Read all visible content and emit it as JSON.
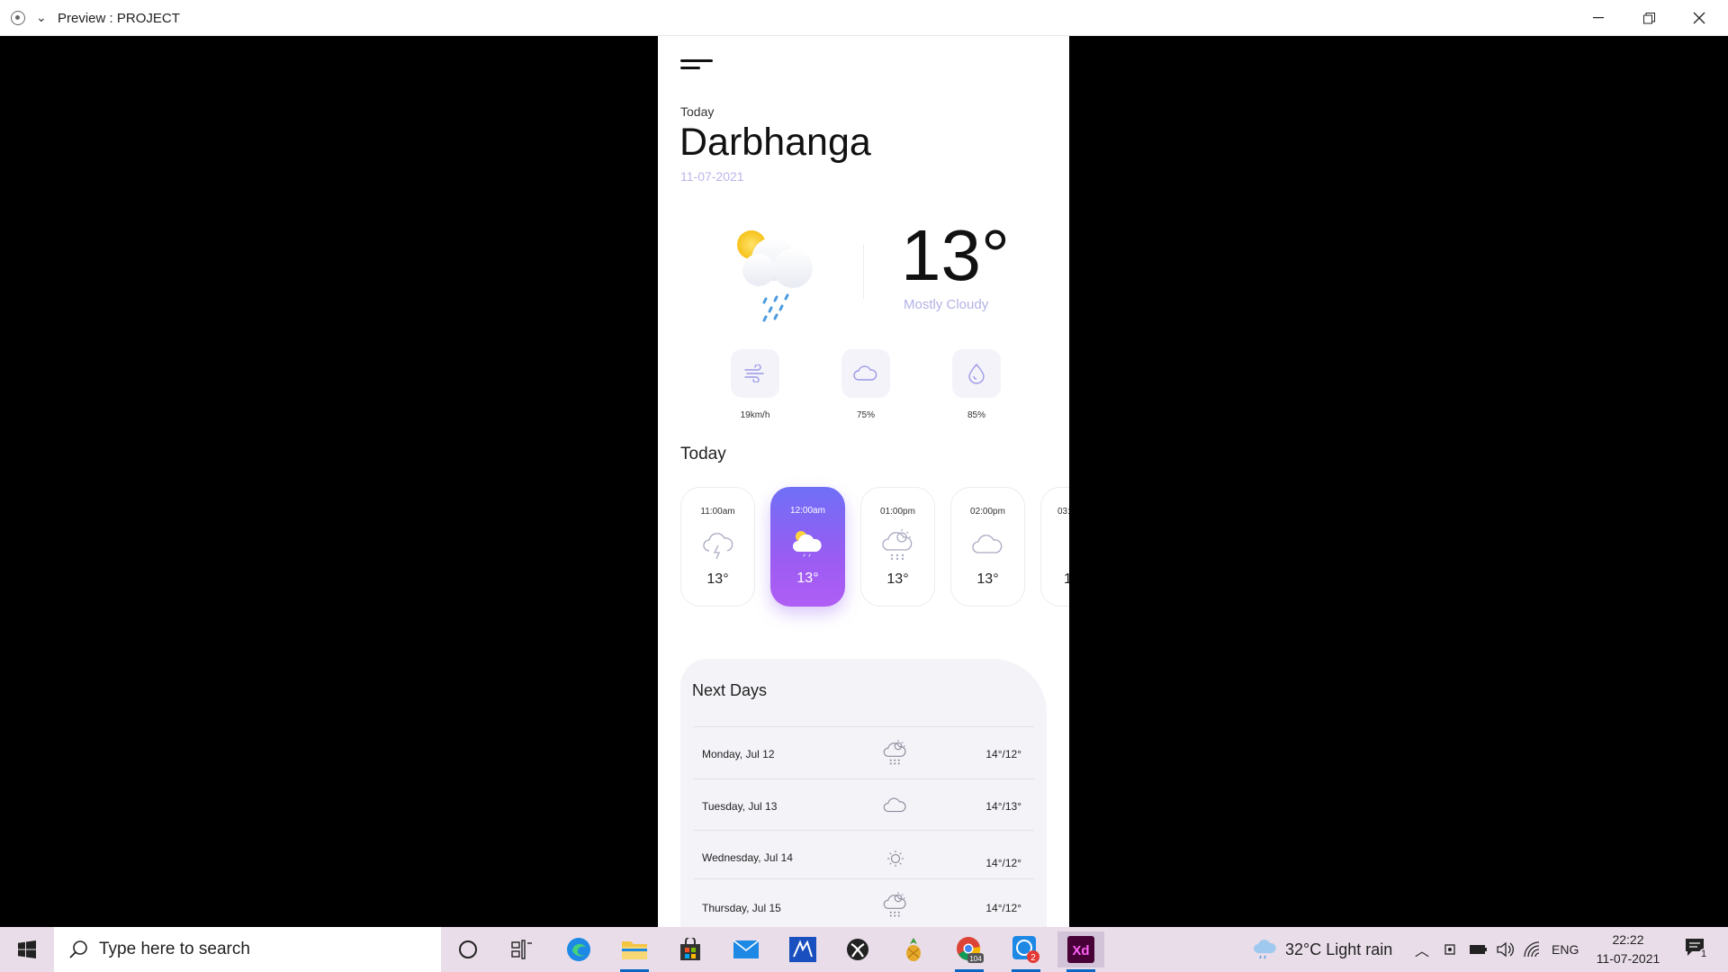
{
  "window": {
    "title": "Preview : PROJECT",
    "controls": [
      "minimize",
      "restore",
      "close"
    ]
  },
  "app": {
    "menu_icon": "hamburger-icon",
    "today_label": "Today",
    "city": "Darbhanga",
    "date": "11-07-2021",
    "current": {
      "temperature": "13°",
      "condition": "Mostly Cloudy",
      "icon": "sun-cloud-rain-icon"
    },
    "stats": [
      {
        "icon": "wind-icon",
        "value": "19km/h"
      },
      {
        "icon": "cloud-icon",
        "value": "75%"
      },
      {
        "icon": "humidity-drop-icon",
        "value": "85%"
      }
    ],
    "hourly_title": "Today",
    "hourly": [
      {
        "time": "11:00am",
        "icon": "thunder-cloud-icon",
        "temp": "13°",
        "active": false
      },
      {
        "time": "12:00am",
        "icon": "sun-cloud-icon",
        "temp": "13°",
        "active": true
      },
      {
        "time": "01:00pm",
        "icon": "sun-cloud-snow-icon",
        "temp": "13°",
        "active": false
      },
      {
        "time": "02:00pm",
        "icon": "cloud-icon",
        "temp": "13°",
        "active": false
      },
      {
        "time": "03:",
        "icon": "sun-icon",
        "temp": "1",
        "active": false
      }
    ],
    "next_days_title": "Next Days",
    "next_days": [
      {
        "day": "Monday, Jul 12",
        "icon": "sun-cloud-snow-icon",
        "temp": "14°/12°"
      },
      {
        "day": "Tuesday, Jul 13",
        "icon": "cloud-icon",
        "temp": "14°/13°"
      },
      {
        "day": "Wednesday, Jul 14",
        "icon": "sun-icon",
        "temp": "14°/12°"
      },
      {
        "day": "Thursday, Jul 15",
        "icon": "sun-cloud-snow-icon",
        "temp": "14°/12°"
      }
    ],
    "colors": {
      "accent_start": "#6f6ff6",
      "accent_end": "#b05ef4",
      "date_text": "#b9b6ea"
    }
  },
  "taskbar": {
    "search_placeholder": "Type here to search",
    "weather": "32°C  Light rain",
    "language": "ENG",
    "time": "22:22",
    "date": "11-07-2021",
    "chrome_badge": "104",
    "app_badge": "2",
    "notification_count": "1"
  }
}
